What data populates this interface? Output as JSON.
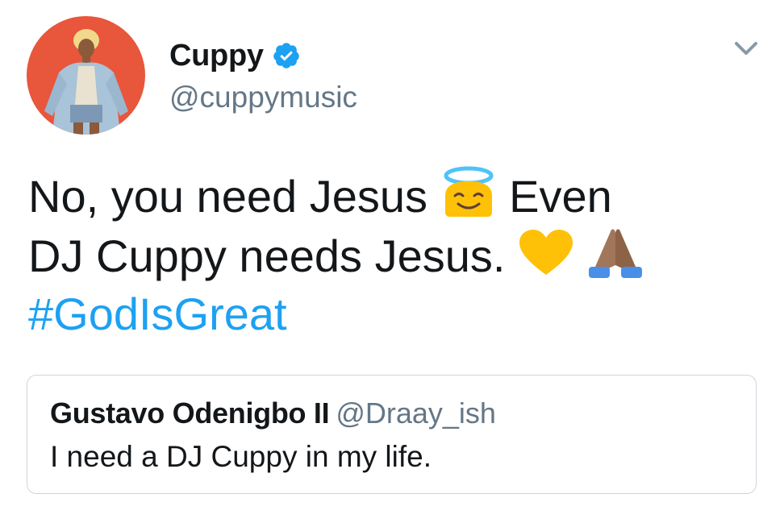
{
  "tweet": {
    "author": {
      "display_name": "Cuppy",
      "handle": "@cuppymusic",
      "verified": true,
      "avatar_icon": "profile-photo"
    },
    "text_line1_a": "No, you need Jesus",
    "text_line1_b": "Even",
    "text_line2": "DJ Cuppy needs Jesus.",
    "hashtag": "#GodIsGreat",
    "emojis": [
      "smiling-face-with-halo-emoji",
      "yellow-heart-emoji",
      "folded-hands-emoji"
    ],
    "menu_icon": "chevron-down-icon"
  },
  "quoted_tweet": {
    "display_name": "Gustavo Odenigbo II",
    "handle": "@Draay_ish",
    "text": "I need a DJ Cuppy in my life."
  },
  "colors": {
    "link_blue": "#1da1f2",
    "secondary_text": "#657786",
    "primary_text": "#14171a",
    "border": "#ccd6dd",
    "avatar_bg": "#e8563b",
    "emoji_yellow": "#ffc107"
  }
}
